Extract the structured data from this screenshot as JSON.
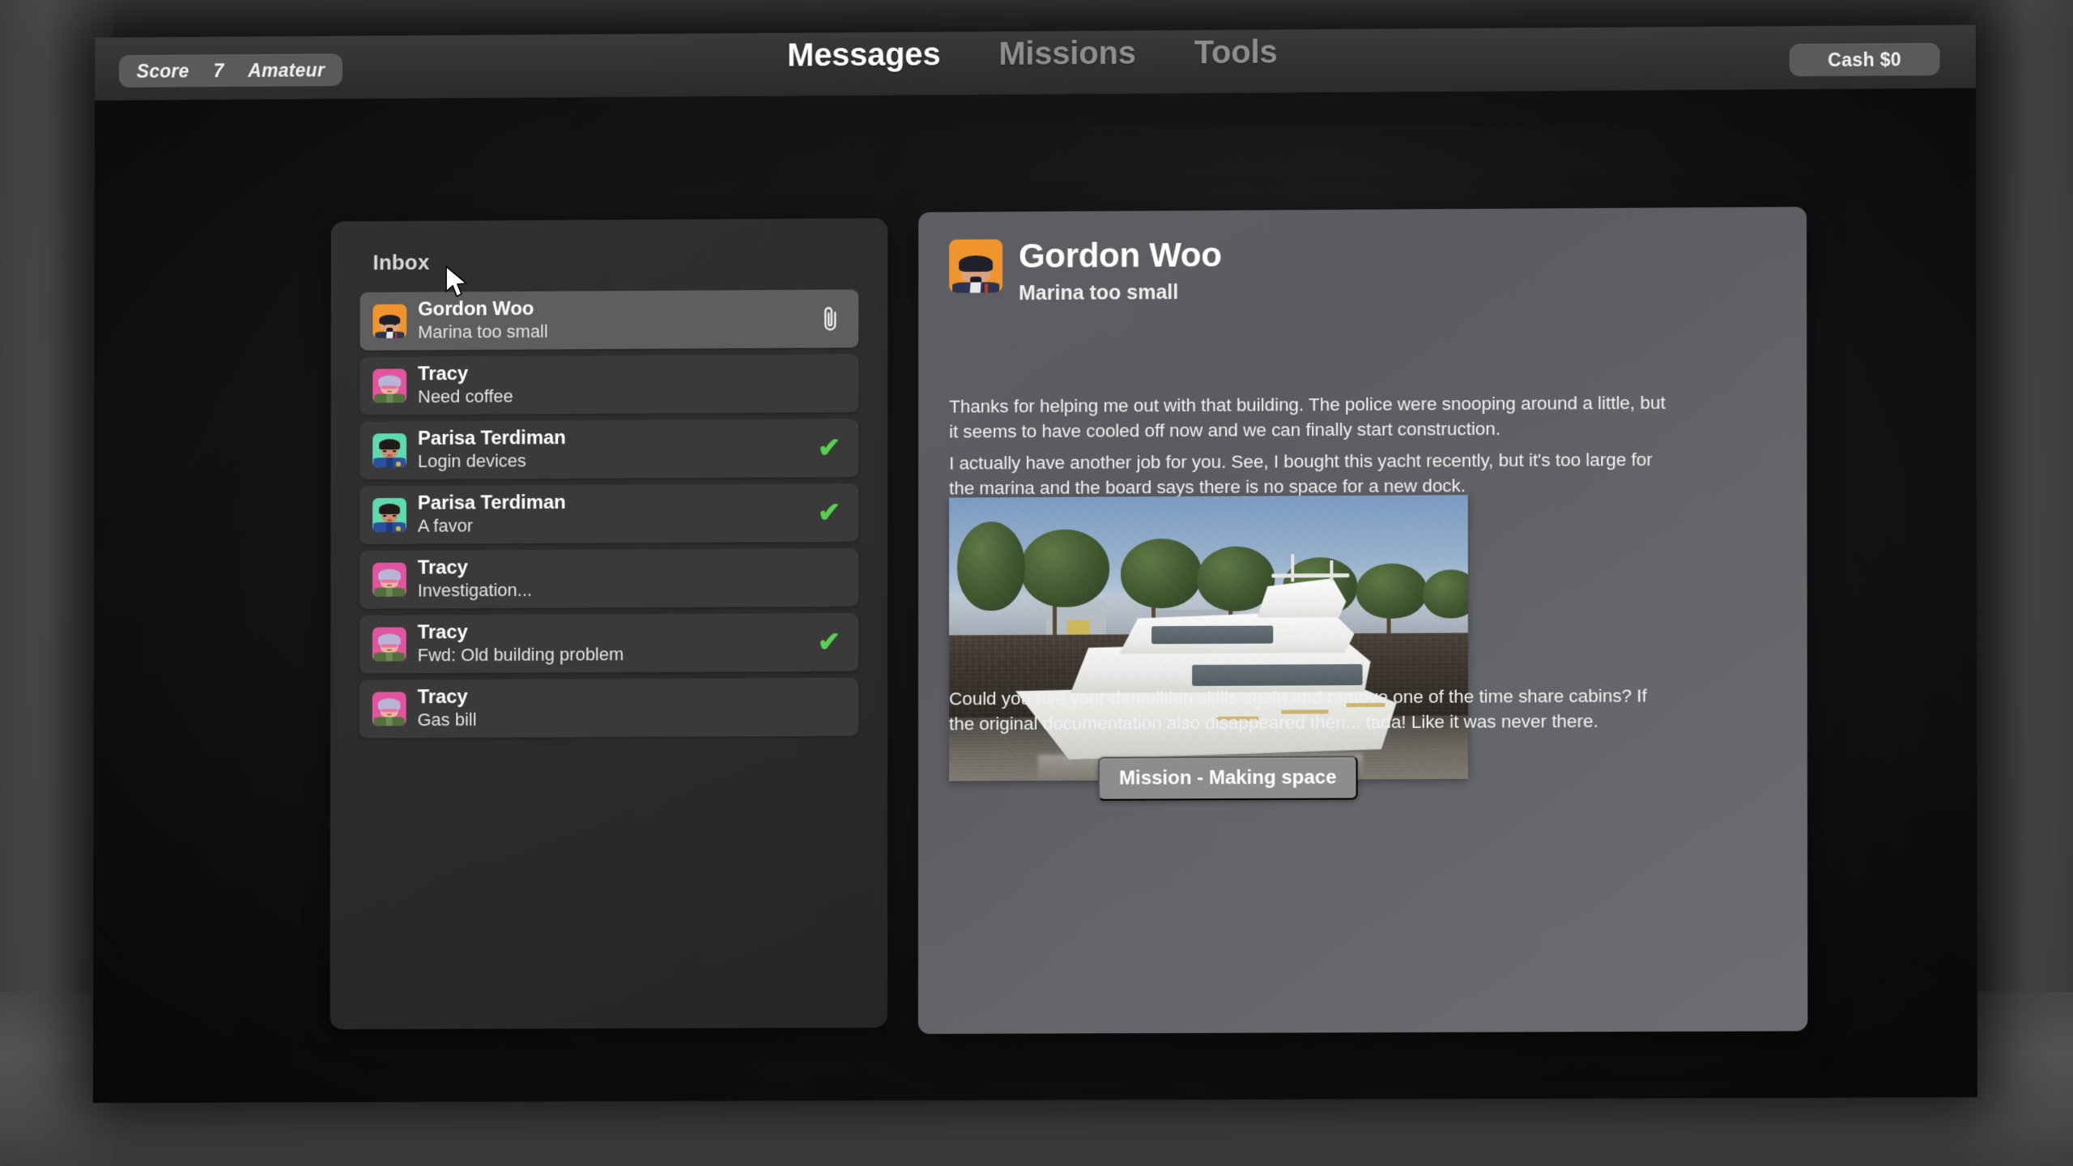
{
  "topbar": {
    "score_label": "Score",
    "score_value": "7",
    "rank_label": "Amateur",
    "cash_label": "Cash $0",
    "tabs": [
      {
        "label": "Messages",
        "active": true
      },
      {
        "label": "Missions",
        "active": false
      },
      {
        "label": "Tools",
        "active": false
      }
    ]
  },
  "inbox": {
    "title": "Inbox",
    "items": [
      {
        "from": "Gordon Woo",
        "subject": "Marina too small",
        "avatar": "gordon",
        "selected": true,
        "attachment": true,
        "done": false
      },
      {
        "from": "Tracy",
        "subject": "Need coffee",
        "avatar": "tracy",
        "selected": false,
        "attachment": false,
        "done": false
      },
      {
        "from": "Parisa Terdiman",
        "subject": "Login devices",
        "avatar": "parisa",
        "selected": false,
        "attachment": false,
        "done": true
      },
      {
        "from": "Parisa Terdiman",
        "subject": "A favor",
        "avatar": "parisa",
        "selected": false,
        "attachment": false,
        "done": true
      },
      {
        "from": "Tracy",
        "subject": "Investigation...",
        "avatar": "tracy",
        "selected": false,
        "attachment": false,
        "done": false
      },
      {
        "from": "Tracy",
        "subject": "Fwd: Old building problem",
        "avatar": "tracy",
        "selected": false,
        "attachment": false,
        "done": true
      },
      {
        "from": "Tracy",
        "subject": "Gas bill",
        "avatar": "tracy",
        "selected": false,
        "attachment": false,
        "done": false
      }
    ]
  },
  "message": {
    "sender": "Gordon Woo",
    "subject": "Marina too small",
    "paragraph1": "Thanks for helping me out with that building. The police were snooping around a little, but it seems to have cooled off now and we can finally start construction.",
    "paragraph2": "I actually have another job for you. See, I bought this yacht recently, but it's too large for the marina and the board says there is no space for a new dock.",
    "paragraph3": "Could you use your demolition skills again and remove one of the time share cabins? If the original documentation also disappeared then... tada! Like it was never there.",
    "image_alt": "Large white yacht moored against a stone canal wall with trees and sky behind",
    "mission_button": "Mission - Making space"
  },
  "colors": {
    "accent_check": "#57cf52",
    "avatar_gordon_bg": "#f0952e",
    "avatar_tracy_bg": "#e0559e",
    "avatar_parisa_bg": "#5fd9b0",
    "selected_row": "#5e5e5e",
    "row": "#3a3a3a",
    "panel_dark": "#2e2e2e",
    "panel_light": "#616368"
  },
  "icons": {
    "attachment": "paperclip-icon",
    "done": "check-icon",
    "cursor": "mouse-cursor"
  }
}
